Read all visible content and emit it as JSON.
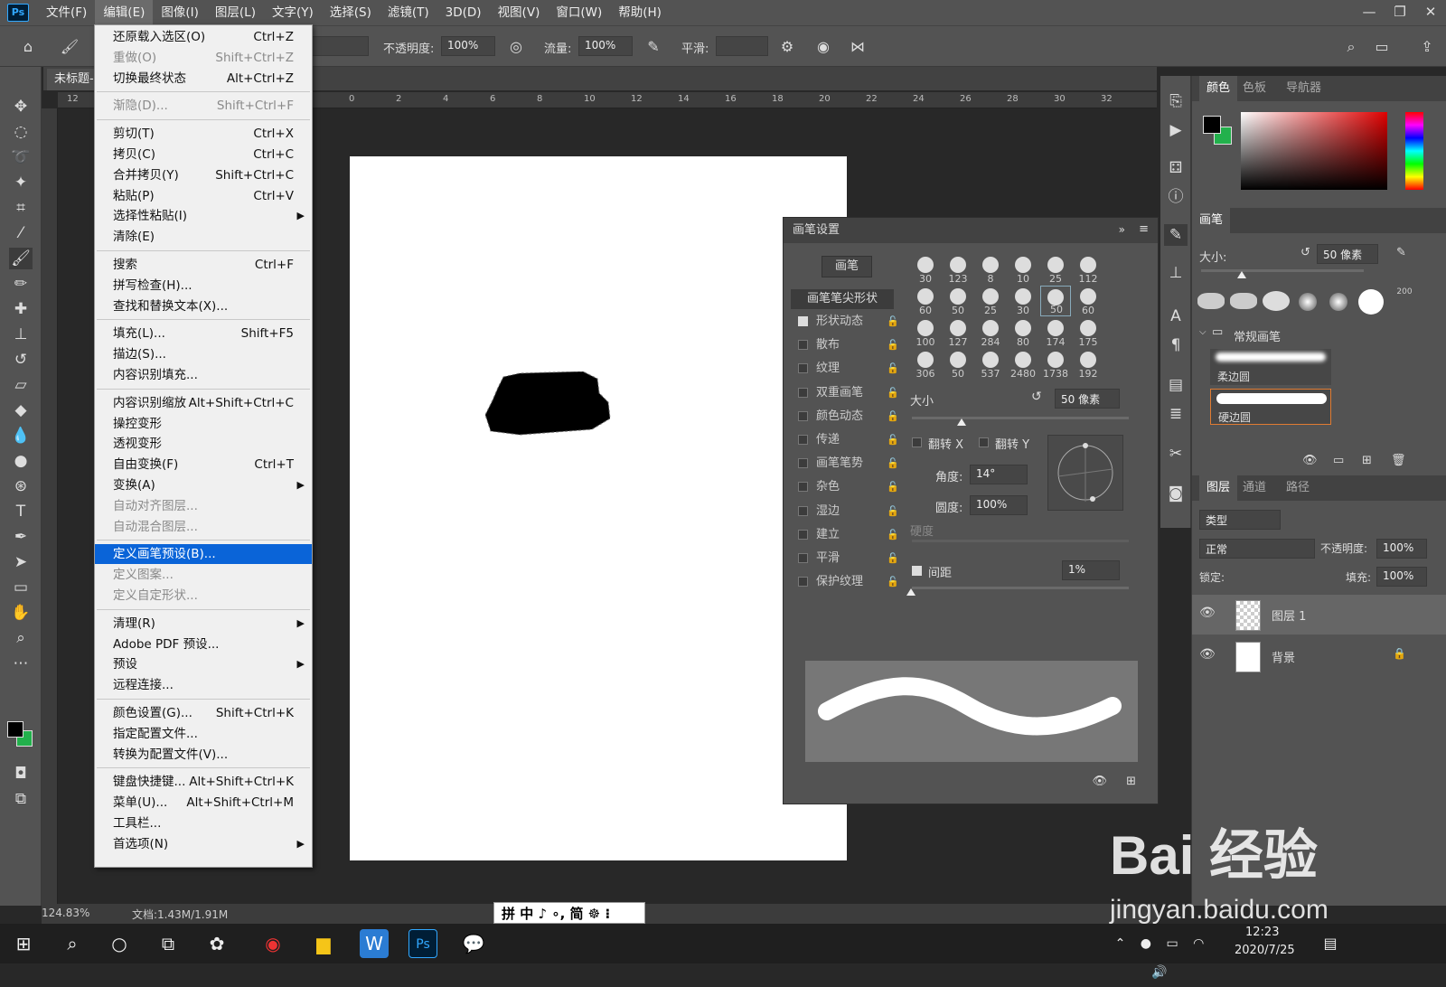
{
  "app": {
    "logo": "Ps"
  },
  "menubar": [
    "文件(F)",
    "编辑(E)",
    "图像(I)",
    "图层(L)",
    "文字(Y)",
    "选择(S)",
    "滤镜(T)",
    "3D(D)",
    "视图(V)",
    "窗口(W)",
    "帮助(H)"
  ],
  "window_controls": {
    "minimize": "—",
    "restore": "❐",
    "close": "✕"
  },
  "options": {
    "opacity_label": "不透明度:",
    "opacity_value": "100%",
    "flow_label": "流量:",
    "flow_value": "100%",
    "smooth_label": "平滑:",
    "smooth_value": ""
  },
  "document": {
    "tab_title": "未标题-",
    "zoom": "124.83%",
    "doc_info": "文档:1.43M/1.91M"
  },
  "ruler_h": [
    "12",
    "0",
    "2",
    "4",
    "6",
    "8",
    "10",
    "12",
    "14",
    "16",
    "18",
    "20",
    "22",
    "24",
    "26",
    "28",
    "30",
    "32"
  ],
  "edit_menu": {
    "items": [
      {
        "label": "还原载入选区(O)",
        "shortcut": "Ctrl+Z",
        "disabled": false
      },
      {
        "label": "重做(O)",
        "shortcut": "Shift+Ctrl+Z",
        "disabled": true
      },
      {
        "label": "切换最终状态",
        "shortcut": "Alt+Ctrl+Z",
        "disabled": false
      },
      {
        "label": "渐隐(D)...",
        "shortcut": "Shift+Ctrl+F",
        "disabled": true
      },
      {
        "label": "剪切(T)",
        "shortcut": "Ctrl+X",
        "disabled": false
      },
      {
        "label": "拷贝(C)",
        "shortcut": "Ctrl+C",
        "disabled": false
      },
      {
        "label": "合并拷贝(Y)",
        "shortcut": "Shift+Ctrl+C",
        "disabled": false
      },
      {
        "label": "粘贴(P)",
        "shortcut": "Ctrl+V",
        "disabled": false
      },
      {
        "label": "选择性粘贴(I)",
        "shortcut": "",
        "disabled": false,
        "submenu": true
      },
      {
        "label": "清除(E)",
        "shortcut": "",
        "disabled": false
      },
      {
        "label": "搜索",
        "shortcut": "Ctrl+F",
        "disabled": false
      },
      {
        "label": "拼写检查(H)...",
        "shortcut": "",
        "disabled": false
      },
      {
        "label": "查找和替换文本(X)...",
        "shortcut": "",
        "disabled": false
      },
      {
        "label": "填充(L)...",
        "shortcut": "Shift+F5",
        "disabled": false
      },
      {
        "label": "描边(S)...",
        "shortcut": "",
        "disabled": false
      },
      {
        "label": "内容识别填充...",
        "shortcut": "",
        "disabled": false
      },
      {
        "label": "内容识别缩放",
        "shortcut": "Alt+Shift+Ctrl+C",
        "disabled": false
      },
      {
        "label": "操控变形",
        "shortcut": "",
        "disabled": false
      },
      {
        "label": "透视变形",
        "shortcut": "",
        "disabled": false
      },
      {
        "label": "自由变换(F)",
        "shortcut": "Ctrl+T",
        "disabled": false
      },
      {
        "label": "变换(A)",
        "shortcut": "",
        "disabled": false,
        "submenu": true
      },
      {
        "label": "自动对齐图层...",
        "shortcut": "",
        "disabled": true
      },
      {
        "label": "自动混合图层...",
        "shortcut": "",
        "disabled": true
      },
      {
        "label": "定义画笔预设(B)...",
        "shortcut": "",
        "disabled": false,
        "selected": true
      },
      {
        "label": "定义图案...",
        "shortcut": "",
        "disabled": true
      },
      {
        "label": "定义自定形状...",
        "shortcut": "",
        "disabled": true
      },
      {
        "label": "清理(R)",
        "shortcut": "",
        "disabled": false,
        "submenu": true
      },
      {
        "label": "Adobe PDF 预设...",
        "shortcut": "",
        "disabled": false
      },
      {
        "label": "预设",
        "shortcut": "",
        "disabled": false,
        "submenu": true
      },
      {
        "label": "远程连接...",
        "shortcut": "",
        "disabled": false
      },
      {
        "label": "颜色设置(G)...",
        "shortcut": "Shift+Ctrl+K",
        "disabled": false
      },
      {
        "label": "指定配置文件...",
        "shortcut": "",
        "disabled": false
      },
      {
        "label": "转换为配置文件(V)...",
        "shortcut": "",
        "disabled": false
      },
      {
        "label": "键盘快捷键...",
        "shortcut": "Alt+Shift+Ctrl+K",
        "disabled": false
      },
      {
        "label": "菜单(U)...",
        "shortcut": "Alt+Shift+Ctrl+M",
        "disabled": false
      },
      {
        "label": "工具栏...",
        "shortcut": "",
        "disabled": false
      },
      {
        "label": "首选项(N)",
        "shortcut": "",
        "disabled": false,
        "submenu": true
      }
    ]
  },
  "brush_settings": {
    "title": "画笔设置",
    "brush_button": "画笔",
    "tip_shape": "画笔笔尖形状",
    "options": [
      {
        "label": "形状动态",
        "checked": true
      },
      {
        "label": "散布",
        "checked": false
      },
      {
        "label": "纹理",
        "checked": false
      },
      {
        "label": "双重画笔",
        "checked": false
      },
      {
        "label": "颜色动态",
        "checked": false
      },
      {
        "label": "传递",
        "checked": false
      },
      {
        "label": "画笔笔势",
        "checked": false
      },
      {
        "label": "杂色",
        "checked": false
      },
      {
        "label": "湿边",
        "checked": false
      },
      {
        "label": "建立",
        "checked": false
      },
      {
        "label": "平滑",
        "checked": false
      },
      {
        "label": "保护纹理",
        "checked": false
      }
    ],
    "tips": [
      "30",
      "123",
      "8",
      "10",
      "25",
      "112",
      "60",
      "50",
      "25",
      "30",
      "50",
      "60",
      "100",
      "127",
      "284",
      "80",
      "174",
      "175",
      "306",
      "50",
      "537",
      "2480",
      "1738",
      "192"
    ],
    "size_label": "大小",
    "size_value": "50 像素",
    "flip_x": "翻转 X",
    "flip_y": "翻转 Y",
    "angle_label": "角度:",
    "angle_value": "14°",
    "roundness_label": "圆度:",
    "roundness_value": "100%",
    "hardness_label": "硬度",
    "spacing_label": "间距",
    "spacing_value": "1%"
  },
  "color_panel": {
    "tabs": [
      "颜色",
      "色板",
      "导航器"
    ],
    "fg": "#000000",
    "bg": "#22b14c"
  },
  "brushes_panel": {
    "title": "画笔",
    "size_label": "大小:",
    "size_value": "50 像素",
    "presets": [
      "200"
    ],
    "group": "常规画笔",
    "items": [
      "柔边圆",
      "硬边圆"
    ]
  },
  "layers_panel": {
    "tabs": [
      "图层",
      "通道",
      "路径"
    ],
    "filter": "类型",
    "blend": "正常",
    "opacity_label": "不透明度:",
    "opacity_value": "100%",
    "lock_label": "锁定:",
    "fill_label": "填充:",
    "fill_value": "100%",
    "layers": [
      "图层 1",
      "背景"
    ]
  },
  "ime": {
    "text": "拼 中 ♪ ∘, 简 ☸ ⁝"
  },
  "taskbar": {
    "time": "12:23",
    "date": "2020/7/25"
  },
  "watermark": {
    "text": "Bai 经验",
    "url": "jingyan.baidu.com"
  }
}
